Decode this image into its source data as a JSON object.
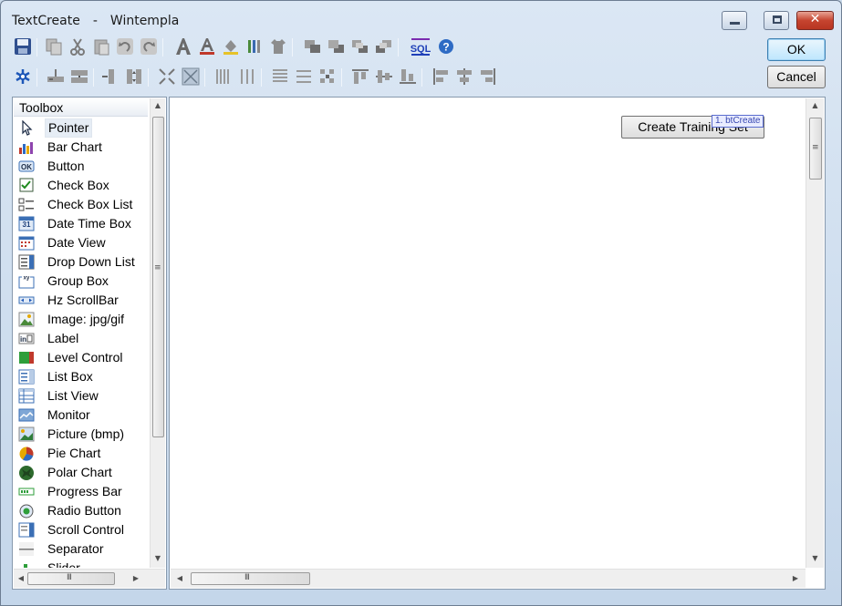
{
  "window": {
    "title_app": "TextCreate",
    "title_separator": "-",
    "title_doc": "Wintempla",
    "controls": {
      "minimize": "minimize",
      "maximize": "maximize",
      "close": "✕"
    }
  },
  "toolbar_row1": [
    "save-icon",
    "copy-icon",
    "cut-icon",
    "paste-icon",
    "undo-icon",
    "redo-icon",
    "font-icon",
    "font-color-icon",
    "fill-color-icon",
    "line-color-icon",
    "shirt-style-icon",
    "bring-to-front-icon",
    "send-to-back-icon",
    "bring-forward-icon",
    "send-backward-icon",
    "sql-icon",
    "help-icon"
  ],
  "toolbar_row2": [
    "snowflake-icon",
    "align-horizontal-center-icon",
    "space-horizontal-icon",
    "align-vertical-center-icon",
    "space-vertical-icon",
    "shrink-icon",
    "expand-icon",
    "columns-equal-icon",
    "columns-icon",
    "rows-equal-icon",
    "rows-icon",
    "grid-icon",
    "align-top-icon",
    "align-middle-icon",
    "align-bottom-icon",
    "align-left-icon",
    "align-center-icon",
    "align-right-icon"
  ],
  "buttons": {
    "ok": "OK",
    "cancel": "Cancel",
    "sql": "SQL"
  },
  "toolbox": {
    "header": "Toolbox",
    "items": [
      {
        "label": "Pointer",
        "icon": "pointer-icon",
        "selected": true
      },
      {
        "label": "Bar Chart",
        "icon": "bar-chart-icon"
      },
      {
        "label": "Button",
        "icon": "button-icon",
        "glyph": "OK"
      },
      {
        "label": "Check Box",
        "icon": "check-box-icon"
      },
      {
        "label": "Check Box List",
        "icon": "check-box-list-icon"
      },
      {
        "label": "Date Time Box",
        "icon": "date-time-box-icon",
        "glyph": "31"
      },
      {
        "label": "Date View",
        "icon": "date-view-icon"
      },
      {
        "label": "Drop Down List",
        "icon": "drop-down-list-icon"
      },
      {
        "label": "Group Box",
        "icon": "group-box-icon",
        "glyph": "xy"
      },
      {
        "label": "Hz ScrollBar",
        "icon": "hz-scrollbar-icon"
      },
      {
        "label": "Image: jpg/gif",
        "icon": "image-icon"
      },
      {
        "label": "Label",
        "icon": "label-icon",
        "glyph": "in"
      },
      {
        "label": "Level Control",
        "icon": "level-control-icon"
      },
      {
        "label": "List Box",
        "icon": "list-box-icon"
      },
      {
        "label": "List View",
        "icon": "list-view-icon"
      },
      {
        "label": "Monitor",
        "icon": "monitor-icon"
      },
      {
        "label": "Picture (bmp)",
        "icon": "picture-icon"
      },
      {
        "label": "Pie Chart",
        "icon": "pie-chart-icon"
      },
      {
        "label": "Polar Chart",
        "icon": "polar-chart-icon"
      },
      {
        "label": "Progress Bar",
        "icon": "progress-bar-icon"
      },
      {
        "label": "Radio Button",
        "icon": "radio-button-icon"
      },
      {
        "label": "Scroll Control",
        "icon": "scroll-control-icon"
      },
      {
        "label": "Separator",
        "icon": "separator-icon"
      },
      {
        "label": "Slider",
        "icon": "slider-icon"
      }
    ]
  },
  "scroll": {
    "grip": "≡",
    "hgrip": "III",
    "up": "▲",
    "down": "▼",
    "left": "◀",
    "right": "▶"
  },
  "canvas": {
    "controls": [
      {
        "label": "Create Training Set",
        "tag": "1. btCreate"
      }
    ]
  },
  "colors": {
    "accent": "#3c7fb1",
    "selection": "#e6edf5",
    "tag": "#5a6ccf"
  }
}
